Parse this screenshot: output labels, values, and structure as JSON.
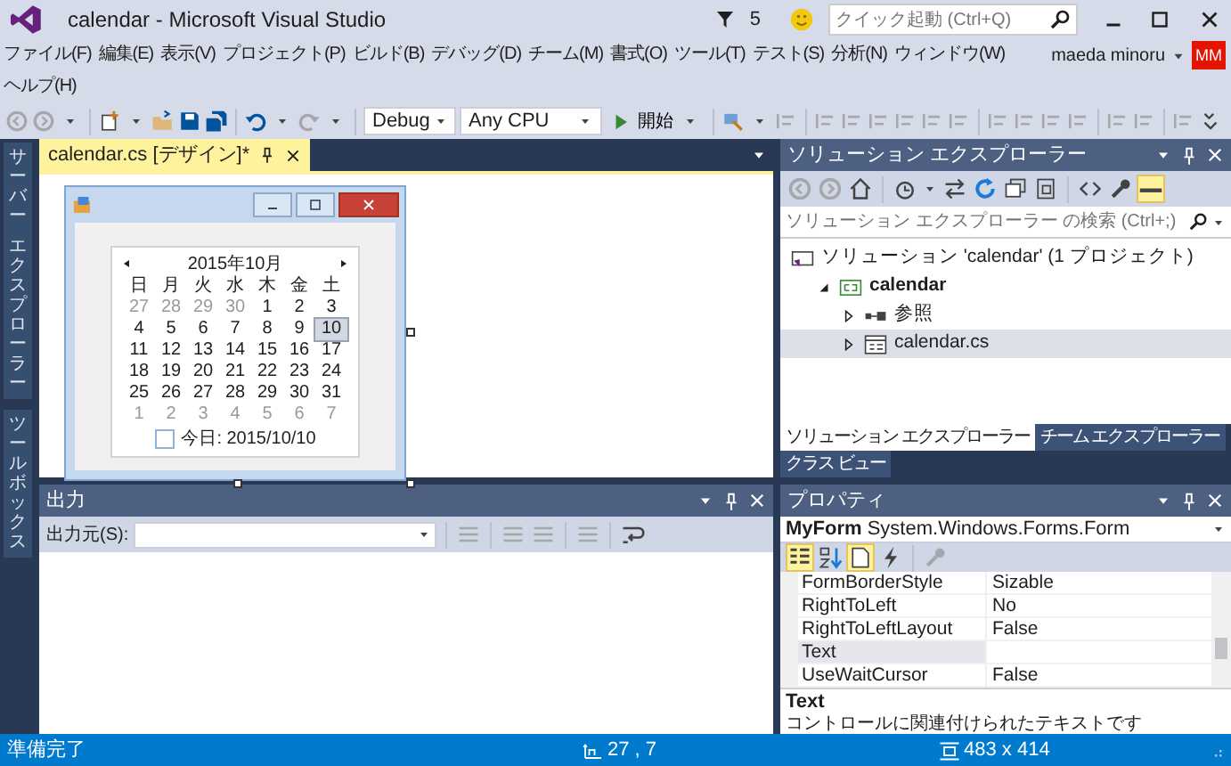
{
  "window": {
    "title": "calendar - Microsoft Visual Studio",
    "notifications": "5",
    "quick_launch": {
      "placeholder": "クイック起動 (Ctrl+Q)"
    }
  },
  "menu": [
    "ファイル(F)",
    "編集(E)",
    "表示(V)",
    "プロジェクト(P)",
    "ビルド(B)",
    "デバッグ(D)",
    "チーム(M)",
    "書式(O)",
    "ツール(T)",
    "テスト(S)",
    "分析(N)",
    "ウィンドウ(W)",
    "ヘルプ(H)"
  ],
  "user": {
    "name": "maeda minoru",
    "initials": "MM"
  },
  "toolbar": [
    {
      "kind": "back",
      "disabled": true
    },
    {
      "kind": "forward",
      "disabled": true,
      "dropdown": true
    },
    {
      "kind": "separator"
    },
    {
      "kind": "newproj",
      "disabled": false,
      "dropdown": true
    },
    {
      "kind": "open",
      "disabled": false
    },
    {
      "kind": "save",
      "disabled": false
    },
    {
      "kind": "saveall",
      "disabled": false
    },
    {
      "kind": "separator"
    },
    {
      "kind": "undo",
      "disabled": false,
      "dropdown": true
    },
    {
      "kind": "redo",
      "disabled": true,
      "dropdown": true
    },
    {
      "kind": "separator"
    },
    {
      "kind": "combo",
      "value": "Debug",
      "disabled": false
    },
    {
      "kind": "combo",
      "value": "Any CPU",
      "disabled": false
    },
    {
      "kind": "start",
      "label": "開始",
      "disabled": false
    },
    {
      "kind": "separator"
    },
    {
      "kind": "find",
      "disabled": false,
      "dropdown": true
    },
    {
      "kind": "align",
      "disabled": true
    },
    {
      "kind": "separator"
    },
    {
      "kind": "align",
      "disabled": true
    },
    {
      "kind": "align",
      "disabled": true
    },
    {
      "kind": "align",
      "disabled": true
    },
    {
      "kind": "align",
      "disabled": true
    },
    {
      "kind": "align",
      "disabled": true
    },
    {
      "kind": "align",
      "disabled": true
    },
    {
      "kind": "separator"
    },
    {
      "kind": "align",
      "disabled": true
    },
    {
      "kind": "align",
      "disabled": true
    },
    {
      "kind": "align",
      "disabled": true
    },
    {
      "kind": "align",
      "disabled": true
    },
    {
      "kind": "separator"
    },
    {
      "kind": "align",
      "disabled": true
    },
    {
      "kind": "align",
      "disabled": true
    },
    {
      "kind": "separator"
    },
    {
      "kind": "align",
      "disabled": true
    },
    {
      "kind": "overflow",
      "disabled": false
    }
  ],
  "side_tabs": [
    [
      "サーバー",
      "エクスプローラー"
    ],
    [
      "ツールボックス"
    ]
  ],
  "document_tab": {
    "label": "calendar.cs [デザイン]*",
    "selected": true
  },
  "calendar": {
    "month": "2015年10月",
    "weekdays": [
      "日",
      "月",
      "火",
      "水",
      "木",
      "金",
      "土"
    ],
    "weeks": [
      [
        {
          "d": "27",
          "other": true,
          "selected": false
        },
        {
          "d": "28",
          "other": true,
          "selected": false
        },
        {
          "d": "29",
          "other": true,
          "selected": false
        },
        {
          "d": "30",
          "other": true,
          "selected": false
        },
        {
          "d": "1",
          "other": false,
          "selected": false
        },
        {
          "d": "2",
          "other": false,
          "selected": false
        },
        {
          "d": "3",
          "other": false,
          "selected": false
        }
      ],
      [
        {
          "d": "4",
          "other": false,
          "selected": false
        },
        {
          "d": "5",
          "other": false,
          "selected": false
        },
        {
          "d": "6",
          "other": false,
          "selected": false
        },
        {
          "d": "7",
          "other": false,
          "selected": false
        },
        {
          "d": "8",
          "other": false,
          "selected": false
        },
        {
          "d": "9",
          "other": false,
          "selected": false
        },
        {
          "d": "10",
          "other": false,
          "selected": true
        }
      ],
      [
        {
          "d": "11",
          "other": false,
          "selected": false
        },
        {
          "d": "12",
          "other": false,
          "selected": false
        },
        {
          "d": "13",
          "other": false,
          "selected": false
        },
        {
          "d": "14",
          "other": false,
          "selected": false
        },
        {
          "d": "15",
          "other": false,
          "selected": false
        },
        {
          "d": "16",
          "other": false,
          "selected": false
        },
        {
          "d": "17",
          "other": false,
          "selected": false
        }
      ],
      [
        {
          "d": "18",
          "other": false,
          "selected": false
        },
        {
          "d": "19",
          "other": false,
          "selected": false
        },
        {
          "d": "20",
          "other": false,
          "selected": false
        },
        {
          "d": "21",
          "other": false,
          "selected": false
        },
        {
          "d": "22",
          "other": false,
          "selected": false
        },
        {
          "d": "23",
          "other": false,
          "selected": false
        },
        {
          "d": "24",
          "other": false,
          "selected": false
        }
      ],
      [
        {
          "d": "25",
          "other": false,
          "selected": false
        },
        {
          "d": "26",
          "other": false,
          "selected": false
        },
        {
          "d": "27",
          "other": false,
          "selected": false
        },
        {
          "d": "28",
          "other": false,
          "selected": false
        },
        {
          "d": "29",
          "other": false,
          "selected": false
        },
        {
          "d": "30",
          "other": false,
          "selected": false
        },
        {
          "d": "31",
          "other": false,
          "selected": false
        }
      ],
      [
        {
          "d": "1",
          "other": true,
          "selected": false
        },
        {
          "d": "2",
          "other": true,
          "selected": false
        },
        {
          "d": "3",
          "other": true,
          "selected": false
        },
        {
          "d": "4",
          "other": true,
          "selected": false
        },
        {
          "d": "5",
          "other": true,
          "selected": false
        },
        {
          "d": "6",
          "other": true,
          "selected": false
        },
        {
          "d": "7",
          "other": true,
          "selected": false
        }
      ]
    ],
    "today": "今日: 2015/10/10"
  },
  "output": {
    "title": "出力",
    "source_label": "出力元(S):",
    "toolbar": [
      {
        "kind": "separator"
      },
      {
        "kind": "lines",
        "disabled": true
      },
      {
        "kind": "separator"
      },
      {
        "kind": "lines",
        "disabled": true
      },
      {
        "kind": "lines",
        "disabled": true
      },
      {
        "kind": "separator"
      },
      {
        "kind": "lines",
        "disabled": true
      },
      {
        "kind": "separator"
      },
      {
        "kind": "wrap",
        "disabled": false
      }
    ]
  },
  "solution_explorer": {
    "title": "ソリューション エクスプローラー",
    "toolbar": [
      {
        "kind": "back",
        "disabled": true,
        "selected": false
      },
      {
        "kind": "forward",
        "disabled": true,
        "selected": false
      },
      {
        "kind": "home",
        "disabled": false,
        "selected": false
      },
      {
        "kind": "separator"
      },
      {
        "kind": "history",
        "disabled": false,
        "selected": false,
        "dropdown": true
      },
      {
        "kind": "sync",
        "disabled": false,
        "selected": false
      },
      {
        "kind": "refresh",
        "disabled": false,
        "selected": false
      },
      {
        "kind": "collapse",
        "disabled": false,
        "selected": false
      },
      {
        "kind": "showall",
        "disabled": false,
        "selected": false
      },
      {
        "kind": "separator"
      },
      {
        "kind": "code",
        "disabled": false,
        "selected": false
      },
      {
        "kind": "wrench",
        "disabled": false,
        "selected": false
      },
      {
        "kind": "preview",
        "disabled": false,
        "selected": true
      }
    ],
    "search": {
      "placeholder": "ソリューション エクスプローラー の検索 (Ctrl+;)"
    },
    "tree": [
      {
        "kind": "solution",
        "label": "ソリューション 'calendar' (1 プロジェクト)",
        "selected": false,
        "children": [
          {
            "kind": "project",
            "label": "calendar",
            "expanded": true,
            "selected": false,
            "children": [
              {
                "kind": "references",
                "label": "参照",
                "expanded": false,
                "selected": false
              },
              {
                "kind": "file",
                "label": "calendar.cs",
                "expanded": false,
                "selected": true
              }
            ]
          }
        ]
      }
    ],
    "tabs": [
      {
        "label": "ソリューション エクスプローラー",
        "selected": true
      },
      {
        "label": "チーム エクスプローラー",
        "selected": false
      },
      {
        "label": "クラス ビュー",
        "selected": false
      }
    ]
  },
  "properties": {
    "title": "プロパティ",
    "object": "**MyForm** System.Windows.Forms.Form",
    "toolbar": [
      {
        "kind": "categorized",
        "disabled": false,
        "selected": true
      },
      {
        "kind": "alpha",
        "disabled": false,
        "selected": false
      },
      {
        "kind": "propsheet",
        "disabled": false,
        "selected": true
      },
      {
        "kind": "events",
        "disabled": false,
        "selected": false
      },
      {
        "kind": "separator"
      },
      {
        "kind": "pages",
        "disabled": true,
        "selected": false
      }
    ],
    "rows": [
      {
        "name": "FormBorderStyle",
        "value": "Sizable",
        "selected": false
      },
      {
        "name": "RightToLeft",
        "value": "No",
        "selected": false
      },
      {
        "name": "RightToLeftLayout",
        "value": "False",
        "selected": false
      },
      {
        "name": "Text",
        "selected": true
      },
      {
        "name": "UseWaitCursor",
        "value": "False",
        "selected": false
      }
    ],
    "description": {
      "title": "Text",
      "text": "コントロールに関連付けられたテキストです"
    }
  },
  "status_bar": {
    "message": "準備完了",
    "position": "27 , 7",
    "size": "483 x 414"
  }
}
